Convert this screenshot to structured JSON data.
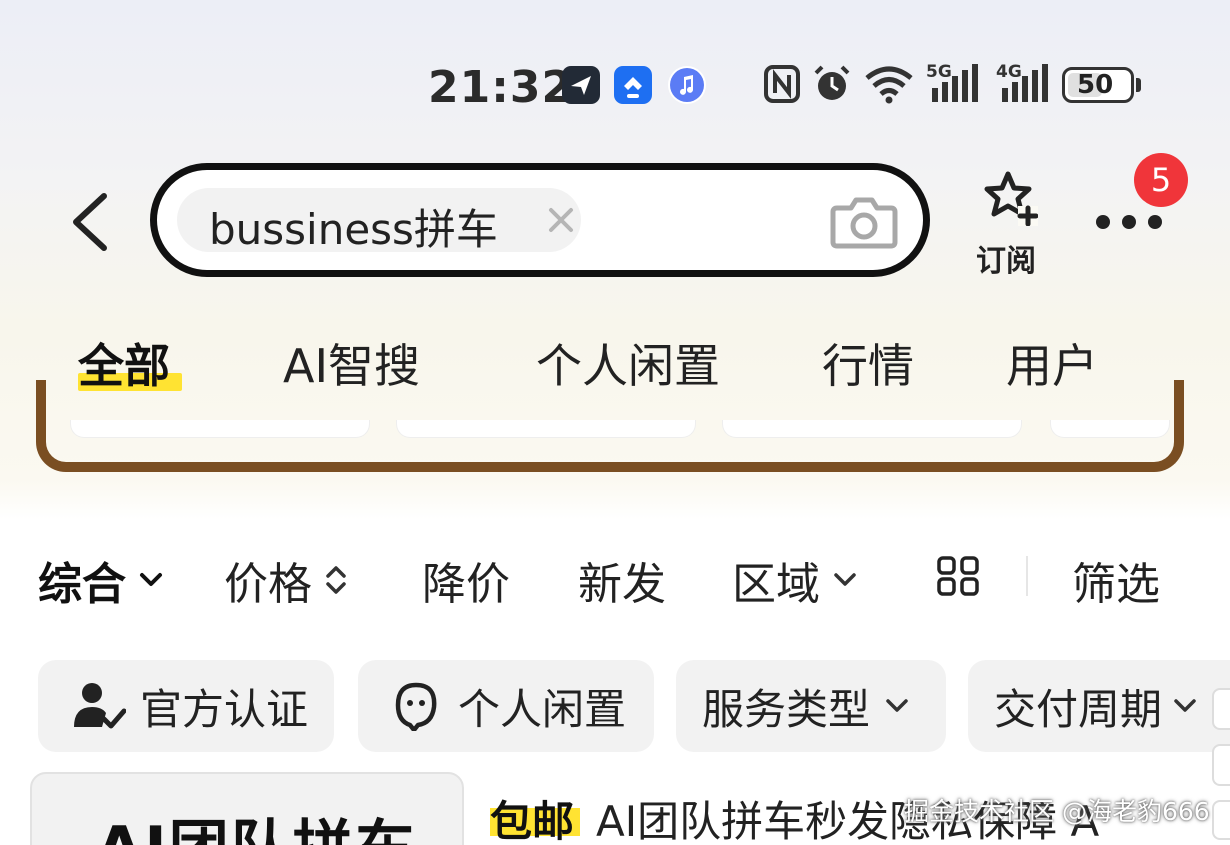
{
  "status_bar": {
    "time": "21:32",
    "app_icons": [
      "paper-plane-icon",
      "ai-search-app-icon",
      "music-icon"
    ],
    "system_icons": [
      "nfc-icon",
      "alarm-icon",
      "wifi-icon",
      "signal-5g-icon",
      "signal-4g-icon",
      "battery-icon"
    ],
    "signal_5g": "5G",
    "signal_4g": "4G",
    "battery": "50"
  },
  "header": {
    "search_query": "bussiness拼车",
    "subscribe_label": "订阅",
    "more_badge": "5"
  },
  "tabs": [
    {
      "label": "全部",
      "active": true
    },
    {
      "label": "AI智搜",
      "active": false
    },
    {
      "label": "个人闲置",
      "active": false
    },
    {
      "label": "行情",
      "active": false
    },
    {
      "label": "用户",
      "active": false
    }
  ],
  "sort_bar": {
    "items": [
      "综合",
      "价格",
      "降价",
      "新发",
      "区域"
    ],
    "filter_label": "筛选"
  },
  "filter_chips": [
    {
      "label": "官方认证",
      "icon": "verified-user-icon"
    },
    {
      "label": "个人闲置",
      "icon": "person-face-icon"
    },
    {
      "label": "服务类型",
      "icon": "chevron-down-icon"
    },
    {
      "label": "交付周期",
      "icon": "chevron-down-icon"
    }
  ],
  "product": {
    "image_text": "AI团队拼车",
    "free_shipping_tag": "包邮",
    "title": "AI团队拼车秒发隐私保障 A"
  },
  "watermark": "掘金技术社区 @海老豹666",
  "colors": {
    "accent_yellow": "#ffe332",
    "badge_red": "#f0353a",
    "frame_brown": "#7a4e22"
  }
}
